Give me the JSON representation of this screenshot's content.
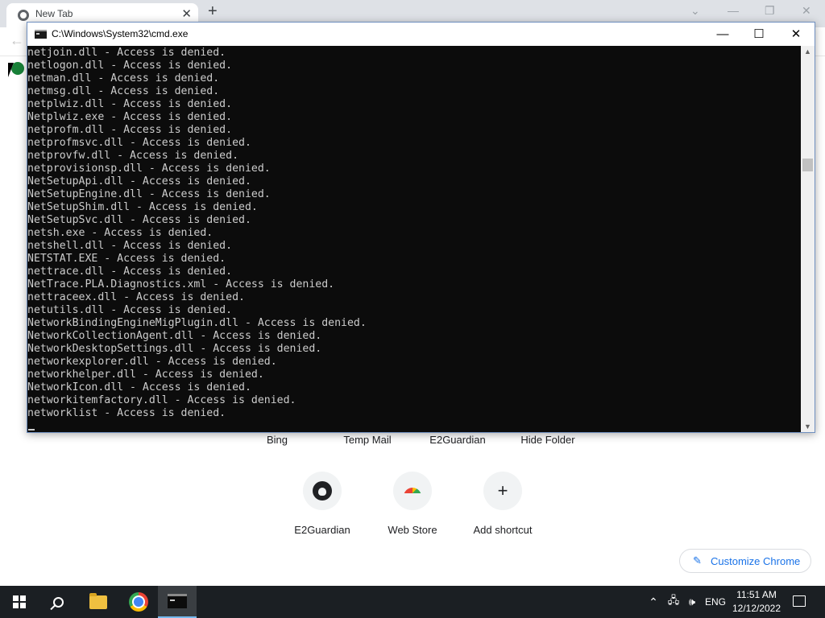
{
  "browser": {
    "tab_title": "New Tab",
    "tab_close": "✕",
    "new_tab": "+",
    "controls": {
      "tabsearch": "⌄",
      "minimize": "—",
      "restore": "❐",
      "close": "✕"
    },
    "back": "←",
    "top_sites_labels": [
      "Bing",
      "Temp Mail",
      "E2Guardian",
      "Hide Folder"
    ],
    "shortcuts": [
      {
        "label": "E2Guardian",
        "icon": "github-icon"
      },
      {
        "label": "Web Store",
        "icon": "webstore-icon"
      },
      {
        "label": "Add shortcut",
        "icon": "plus-icon"
      }
    ],
    "customize_label": "Customize Chrome"
  },
  "cmd": {
    "title": "C:\\Windows\\System32\\cmd.exe",
    "buttons": {
      "minimize": "—",
      "maximize": "☐",
      "close": "✕"
    },
    "lines": [
      "netjoin.dll - Access is denied.",
      "netlogon.dll - Access is denied.",
      "netman.dll - Access is denied.",
      "netmsg.dll - Access is denied.",
      "netplwiz.dll - Access is denied.",
      "Netplwiz.exe - Access is denied.",
      "netprofm.dll - Access is denied.",
      "netprofmsvc.dll - Access is denied.",
      "netprovfw.dll - Access is denied.",
      "netprovisionsp.dll - Access is denied.",
      "NetSetupApi.dll - Access is denied.",
      "NetSetupEngine.dll - Access is denied.",
      "NetSetupShim.dll - Access is denied.",
      "NetSetupSvc.dll - Access is denied.",
      "netsh.exe - Access is denied.",
      "netshell.dll - Access is denied.",
      "NETSTAT.EXE - Access is denied.",
      "nettrace.dll - Access is denied.",
      "NetTrace.PLA.Diagnostics.xml - Access is denied.",
      "nettraceex.dll - Access is denied.",
      "netutils.dll - Access is denied.",
      "NetworkBindingEngineMigPlugin.dll - Access is denied.",
      "NetworkCollectionAgent.dll - Access is denied.",
      "NetworkDesktopSettings.dll - Access is denied.",
      "networkexplorer.dll - Access is denied.",
      "networkhelper.dll - Access is denied.",
      "NetworkIcon.dll - Access is denied.",
      "networkitemfactory.dll - Access is denied.",
      "networklist - Access is denied."
    ]
  },
  "taskbar": {
    "tray": {
      "chevron": "⌃",
      "network": "🖧",
      "volume": "🕪",
      "language": "ENG"
    },
    "time": "11:51 AM",
    "date": "12/12/2022"
  },
  "colors": {
    "console_bg": "#0c0c0c",
    "console_fg": "#cccccc",
    "taskbar_bg": "#1b1f23",
    "accent": "#1a73e8"
  }
}
